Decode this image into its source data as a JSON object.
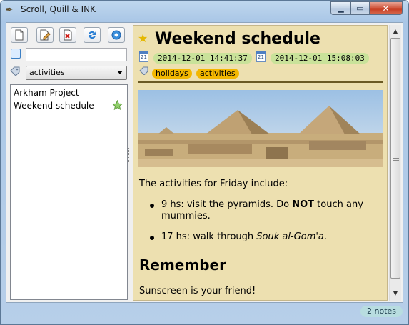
{
  "window": {
    "title": "Scroll, Quill & INK"
  },
  "toolbar": {
    "buttons": [
      {
        "name": "new-note-button",
        "icon": "new-page-icon"
      },
      {
        "name": "edit-note-button",
        "icon": "edit-page-icon"
      },
      {
        "name": "delete-note-button",
        "icon": "delete-page-icon"
      },
      {
        "name": "sync-button",
        "icon": "sync-icon"
      },
      {
        "name": "settings-button",
        "icon": "gear-icon"
      }
    ]
  },
  "search": {
    "value": "",
    "placeholder": ""
  },
  "tag_filter": {
    "selected": "activities"
  },
  "notes": [
    {
      "title": "Arkham Project",
      "starred": false
    },
    {
      "title": "Weekend schedule",
      "starred": true
    }
  ],
  "note": {
    "title": "Weekend schedule",
    "created": "2014-12-01 14:41:37",
    "modified": "2014-12-01 15:08:03",
    "calendar_day": "21",
    "tags": [
      "holidays",
      "activities"
    ],
    "intro": "The activities for Friday include:",
    "items": [
      {
        "pre": "9 hs: visit the pyramids. Do ",
        "bold": "NOT",
        "post": " touch any",
        "line2": "mummies."
      },
      {
        "pre": "17 hs: walk through ",
        "italic": "Souk al-Gom'a",
        "post": "."
      }
    ],
    "heading": "Remember",
    "footer": "Sunscreen is your friend!"
  },
  "status": {
    "note_count": "2 notes"
  },
  "colors": {
    "content_bg": "#ede0b0",
    "date_badge": "#c9e29a",
    "tag_badge": "#f3b700",
    "status_badge": "#b8dde0",
    "star": "#e5b800"
  }
}
